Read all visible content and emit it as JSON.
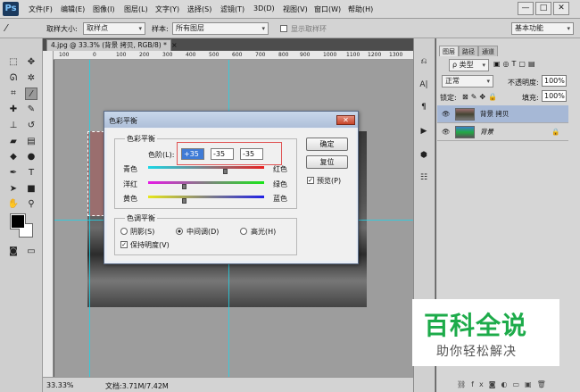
{
  "app": {
    "logo": "Ps"
  },
  "menu": [
    "文件(F)",
    "编辑(E)",
    "图像(I)",
    "图层(L)",
    "文字(Y)",
    "选择(S)",
    "滤镜(T)",
    "3D(D)",
    "视图(V)",
    "窗口(W)",
    "帮助(H)"
  ],
  "window_controls": {
    "minimize": "—",
    "maximize": "□",
    "close": "✕"
  },
  "options_bar": {
    "sample_size_label": "取样大小:",
    "sample_size_value": "取样点",
    "sample_label": "样本:",
    "sample_value": "所有图层",
    "show_ring_label": "显示取样环",
    "workspace": "基本功能"
  },
  "document_tab": {
    "title": "4.jpg @ 33.3% (背景 拷贝, RGB/8) *",
    "close": "×"
  },
  "ruler_ticks": [
    "100",
    "0",
    "100",
    "200",
    "300",
    "400",
    "500",
    "600",
    "700",
    "800",
    "900",
    "1000",
    "1100",
    "1200",
    "1300",
    "1400",
    "150"
  ],
  "status": {
    "zoom": "33.33%",
    "doc": "文档:3.71M/7.42M"
  },
  "dialog": {
    "title": "色彩平衡",
    "balance_group": "色彩平衡",
    "levels_label": "色阶(L):",
    "levels": [
      "+35",
      "-35",
      "-35"
    ],
    "sliders": [
      {
        "left": "青色",
        "right": "红色",
        "value": 35
      },
      {
        "left": "洋红",
        "right": "绿色",
        "value": -35
      },
      {
        "left": "黄色",
        "right": "蓝色",
        "value": -35
      }
    ],
    "tone_group": "色调平衡",
    "tones": [
      "阴影(S)",
      "中间调(D)",
      "高光(H)"
    ],
    "selected_tone": 1,
    "preserve_label": "保持明度(V)",
    "ok": "确定",
    "reset": "复位",
    "preview": "预览(P)"
  },
  "panels": {
    "tabs": [
      "图层",
      "路径",
      "通道"
    ],
    "filter_label": "ρ 类型",
    "blend_mode": "正常",
    "opacity_label": "不透明度:",
    "opacity_value": "100%",
    "lock_label": "锁定:",
    "fill_label": "填充:",
    "fill_value": "100%",
    "layers": [
      {
        "name": "背景 拷贝",
        "selected": true
      },
      {
        "name": "背景",
        "selected": false,
        "locked": true
      }
    ],
    "footer_icons": [
      "link-icon",
      "fx-icon",
      "mask-icon",
      "adjust-icon",
      "folder-icon",
      "new-layer-icon",
      "trash-icon"
    ]
  },
  "watermark": {
    "title": "百科全说",
    "subtitle": "助你轻松解决"
  }
}
